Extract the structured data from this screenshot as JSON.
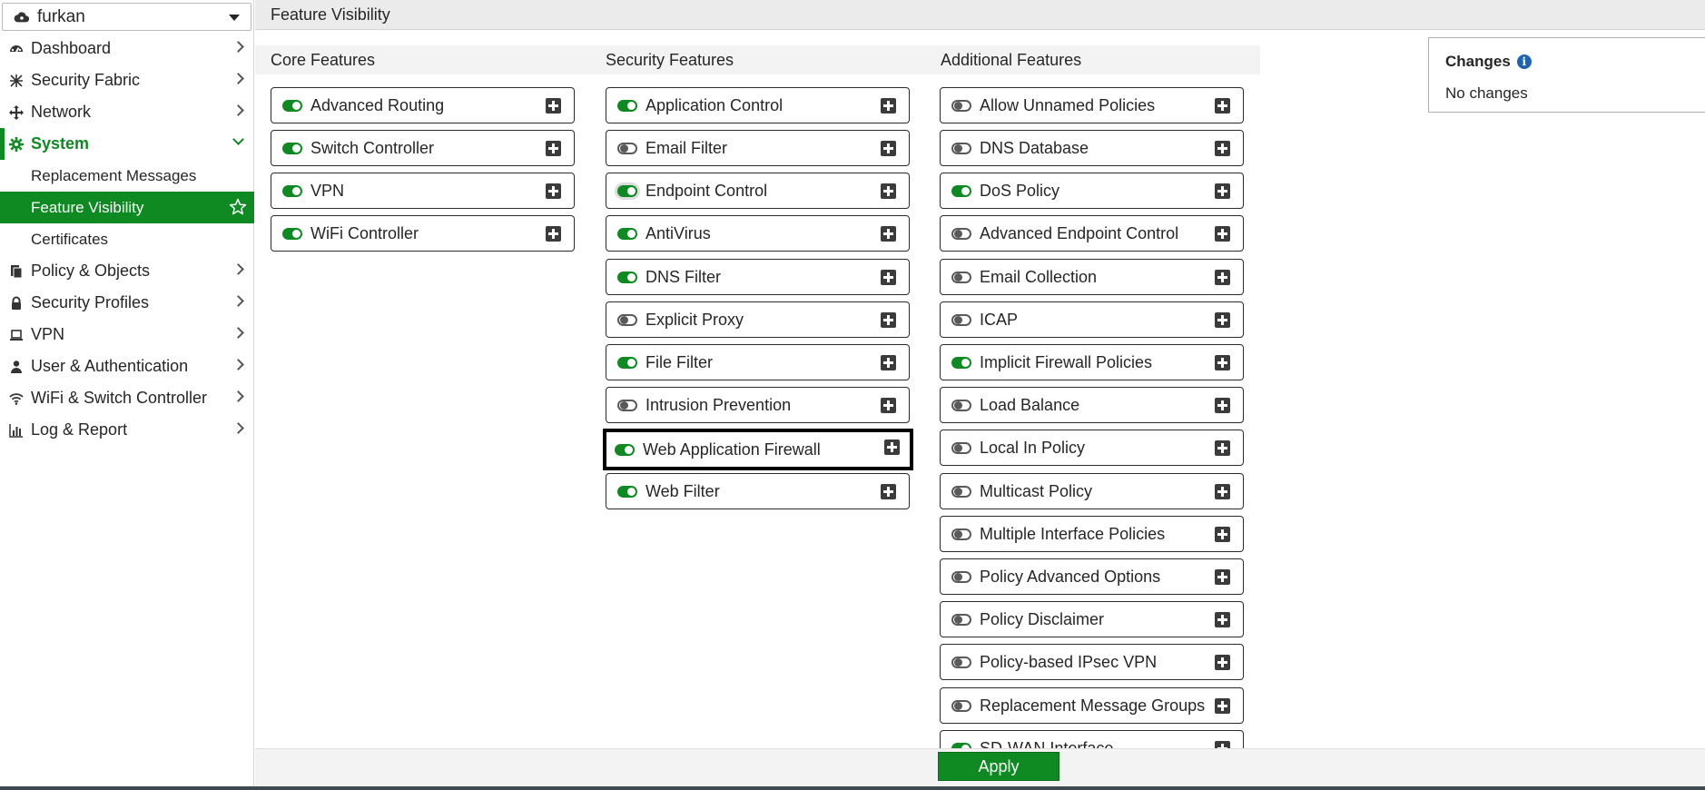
{
  "vdom": {
    "name": "furkan"
  },
  "sidebar": {
    "items": [
      {
        "label": "Dashboard",
        "icon": "dashboard-icon"
      },
      {
        "label": "Security Fabric",
        "icon": "security-fabric-icon"
      },
      {
        "label": "Network",
        "icon": "network-icon"
      },
      {
        "label": "System",
        "icon": "gear-icon"
      },
      {
        "label": "Policy & Objects",
        "icon": "policy-icon"
      },
      {
        "label": "Security Profiles",
        "icon": "lock-icon"
      },
      {
        "label": "VPN",
        "icon": "laptop-icon"
      },
      {
        "label": "User & Authentication",
        "icon": "user-icon"
      },
      {
        "label": "WiFi & Switch Controller",
        "icon": "wifi-icon"
      },
      {
        "label": "Log & Report",
        "icon": "chart-icon"
      }
    ],
    "system_sub": [
      {
        "label": "Replacement Messages"
      },
      {
        "label": "Feature Visibility"
      },
      {
        "label": "Certificates"
      }
    ]
  },
  "header": {
    "title": "Feature Visibility"
  },
  "columns": {
    "core": {
      "title": "Core Features",
      "items": [
        {
          "label": "Advanced Routing",
          "enabled": true
        },
        {
          "label": "Switch Controller",
          "enabled": true
        },
        {
          "label": "VPN",
          "enabled": true
        },
        {
          "label": "WiFi Controller",
          "enabled": true
        }
      ]
    },
    "security": {
      "title": "Security Features",
      "items": [
        {
          "label": "Application Control",
          "enabled": true
        },
        {
          "label": "Email Filter",
          "enabled": false
        },
        {
          "label": "Endpoint Control",
          "enabled": true
        },
        {
          "label": "AntiVirus",
          "enabled": true
        },
        {
          "label": "DNS Filter",
          "enabled": true
        },
        {
          "label": "Explicit Proxy",
          "enabled": false
        },
        {
          "label": "File Filter",
          "enabled": true
        },
        {
          "label": "Intrusion Prevention",
          "enabled": false
        },
        {
          "label": "Web Application Firewall",
          "enabled": true
        },
        {
          "label": "Web Filter",
          "enabled": true
        }
      ]
    },
    "additional": {
      "title": "Additional Features",
      "items": [
        {
          "label": "Allow Unnamed Policies",
          "enabled": false
        },
        {
          "label": "DNS Database",
          "enabled": false
        },
        {
          "label": "DoS Policy",
          "enabled": true
        },
        {
          "label": "Advanced Endpoint Control",
          "enabled": false
        },
        {
          "label": "Email Collection",
          "enabled": false
        },
        {
          "label": "ICAP",
          "enabled": false
        },
        {
          "label": "Implicit Firewall Policies",
          "enabled": true
        },
        {
          "label": "Load Balance",
          "enabled": false
        },
        {
          "label": "Local In Policy",
          "enabled": false
        },
        {
          "label": "Multicast Policy",
          "enabled": false
        },
        {
          "label": "Multiple Interface Policies",
          "enabled": false
        },
        {
          "label": "Policy Advanced Options",
          "enabled": false
        },
        {
          "label": "Policy Disclaimer",
          "enabled": false
        },
        {
          "label": "Policy-based IPsec VPN",
          "enabled": false
        },
        {
          "label": "Replacement Message Groups",
          "enabled": false
        },
        {
          "label": "SD-WAN Interface",
          "enabled": true
        }
      ]
    }
  },
  "changes": {
    "title": "Changes",
    "value": "No changes"
  },
  "footer": {
    "apply_label": "Apply"
  },
  "colors": {
    "accent": "#0f8a23",
    "info": "#1f64b0"
  }
}
